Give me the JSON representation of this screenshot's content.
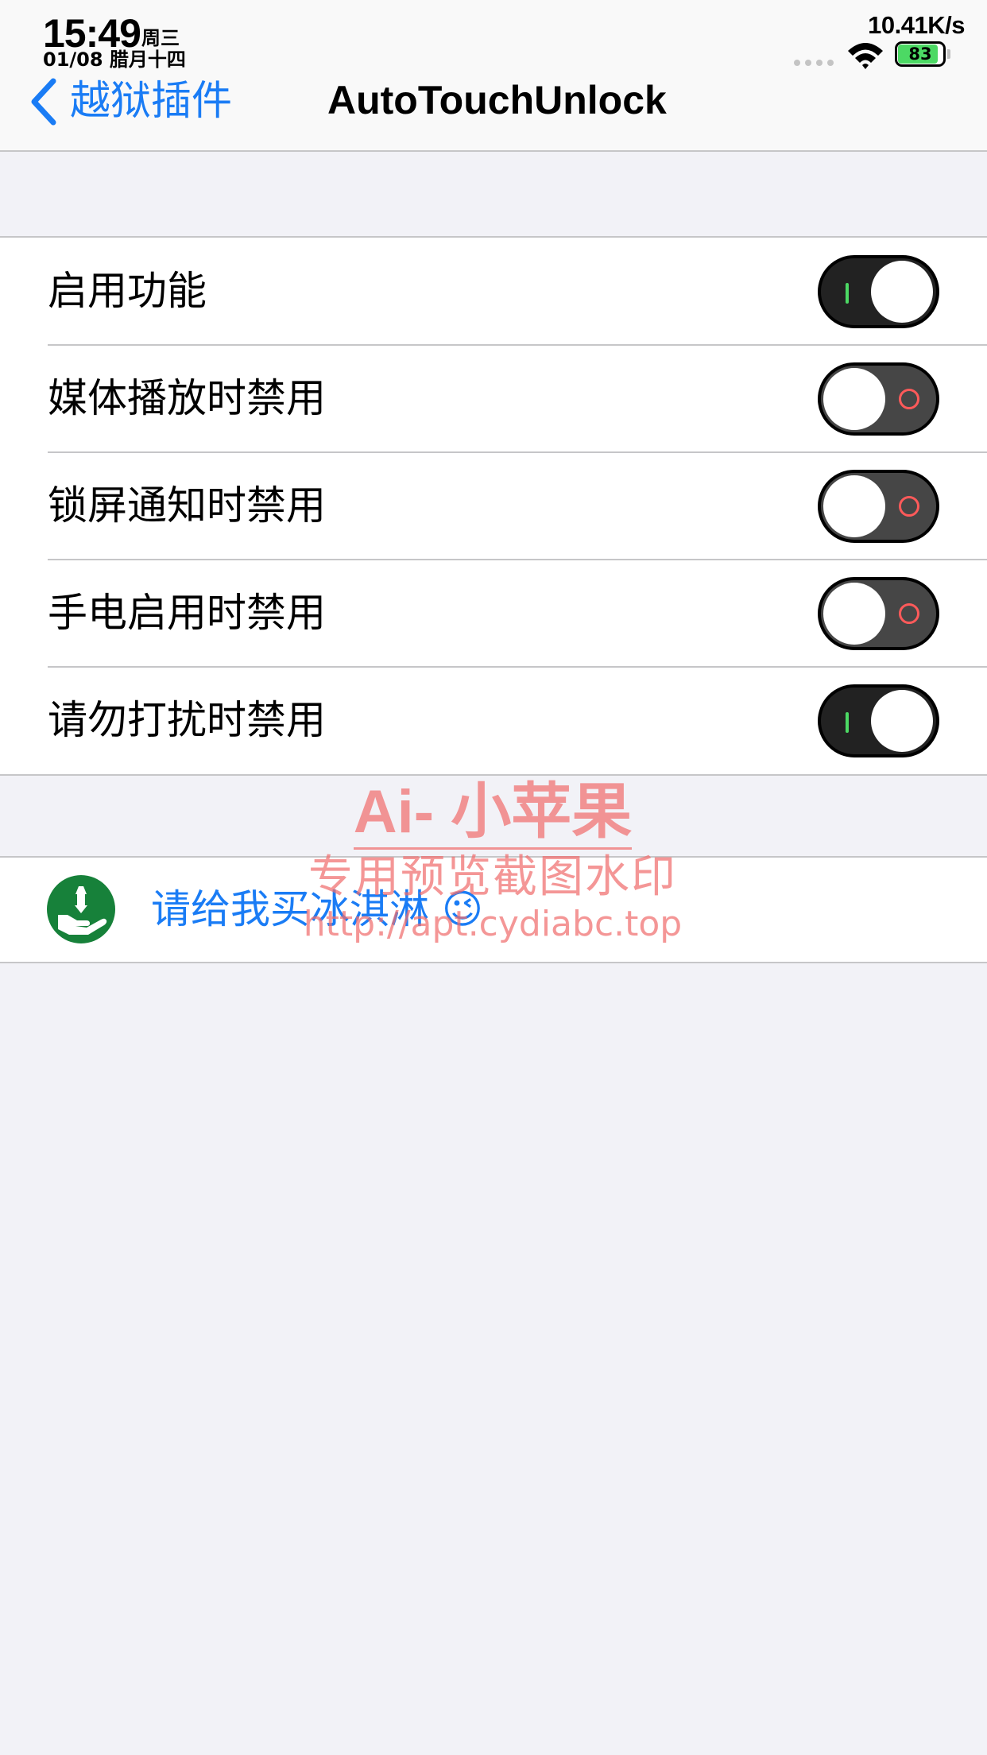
{
  "status_bar": {
    "time": "15:49",
    "weekday": "周三",
    "date": "01/08 腊月十四",
    "net_speed": "10.41K/s",
    "battery_level": "83"
  },
  "nav": {
    "back_label": "越狱插件",
    "title": "AutoTouchUnlock"
  },
  "settings": [
    {
      "label": "启用功能",
      "enabled": true
    },
    {
      "label": "媒体播放时禁用",
      "enabled": false
    },
    {
      "label": "锁屏通知时禁用",
      "enabled": false
    },
    {
      "label": "手电启用时禁用",
      "enabled": false
    },
    {
      "label": "请勿打扰时禁用",
      "enabled": true
    }
  ],
  "donate": {
    "label": "请给我买冰淇淋 😉",
    "icon": "donate-hand-icon"
  },
  "watermark": {
    "title": "Ai- 小苹果",
    "subtitle": "专用预览截图水印",
    "url": "http://apt.cydiabc.top"
  },
  "colors": {
    "accent": "#1a7cf5",
    "switch_on_indicator": "#4cd964",
    "switch_off_indicator": "#ff5a5a",
    "donate_icon_bg": "#17813a",
    "watermark": "#f06e6e"
  }
}
